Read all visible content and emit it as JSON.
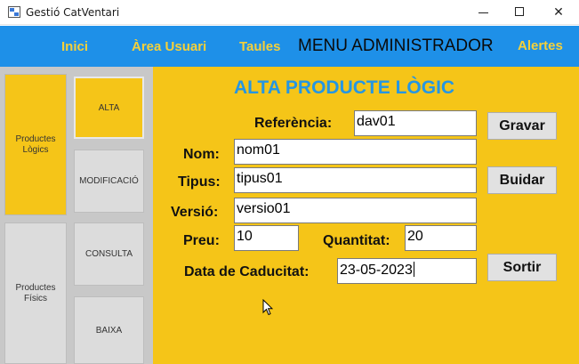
{
  "window": {
    "title": "Gestió CatVentari",
    "minimize_glyph": "—",
    "close_glyph": "✕"
  },
  "menu": {
    "inici": "Inici",
    "area_usuari": "Àrea Usuari",
    "taules": "Taules",
    "admin": "MENU ADMINISTRADOR",
    "alertes": "Alertes"
  },
  "sidebar": {
    "categories": {
      "logics": "Productes Lògics",
      "fisics": "Productes Físics"
    },
    "actions": {
      "alta": "ALTA",
      "modificacio": "MODIFICACIÓ",
      "consulta": "CONSULTA",
      "baixa": "BAIXA"
    }
  },
  "form": {
    "title": "ALTA PRODUCTE LÒGIC",
    "referencia": {
      "label": "Referència:",
      "value": "dav01"
    },
    "nom": {
      "label": "Nom:",
      "value": "nom01"
    },
    "tipus": {
      "label": "Tipus:",
      "value": "tipus01"
    },
    "versio": {
      "label": "Versió:",
      "value": "versio01"
    },
    "preu": {
      "label": "Preu:",
      "value": "10"
    },
    "quantitat": {
      "label": "Quantitat:",
      "value": "20"
    },
    "data_caducitat": {
      "label": "Data de Caducitat:",
      "value": "23-05-2023"
    },
    "buttons": {
      "gravar": "Gravar",
      "buidar": "Buidar",
      "sortir": "Sortir"
    }
  },
  "colors": {
    "menu_bg": "#1e90e8",
    "menu_text": "#f5d03a",
    "form_bg": "#f5c518",
    "title_color": "#2596e3"
  }
}
